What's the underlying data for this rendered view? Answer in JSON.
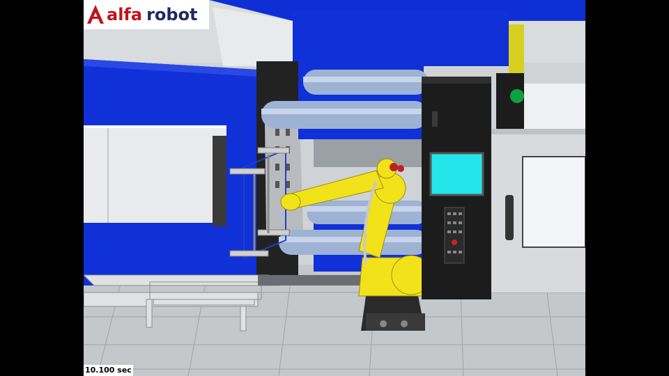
{
  "logo": {
    "brand_prefix": "alfa",
    "brand_suffix": "robot",
    "mark_name": "alfa-robot-logo-mark"
  },
  "simulation": {
    "elapsed_time": "10.100 sec"
  },
  "colors": {
    "machine_blue": "#1030d8",
    "robot_yellow": "#f2e21a",
    "controller_black": "#1c1c1c",
    "screen_cyan": "#22e6ea",
    "floor_grey": "#c8cbcd",
    "logo_red": "#c0141c",
    "logo_navy": "#1f2a63"
  }
}
